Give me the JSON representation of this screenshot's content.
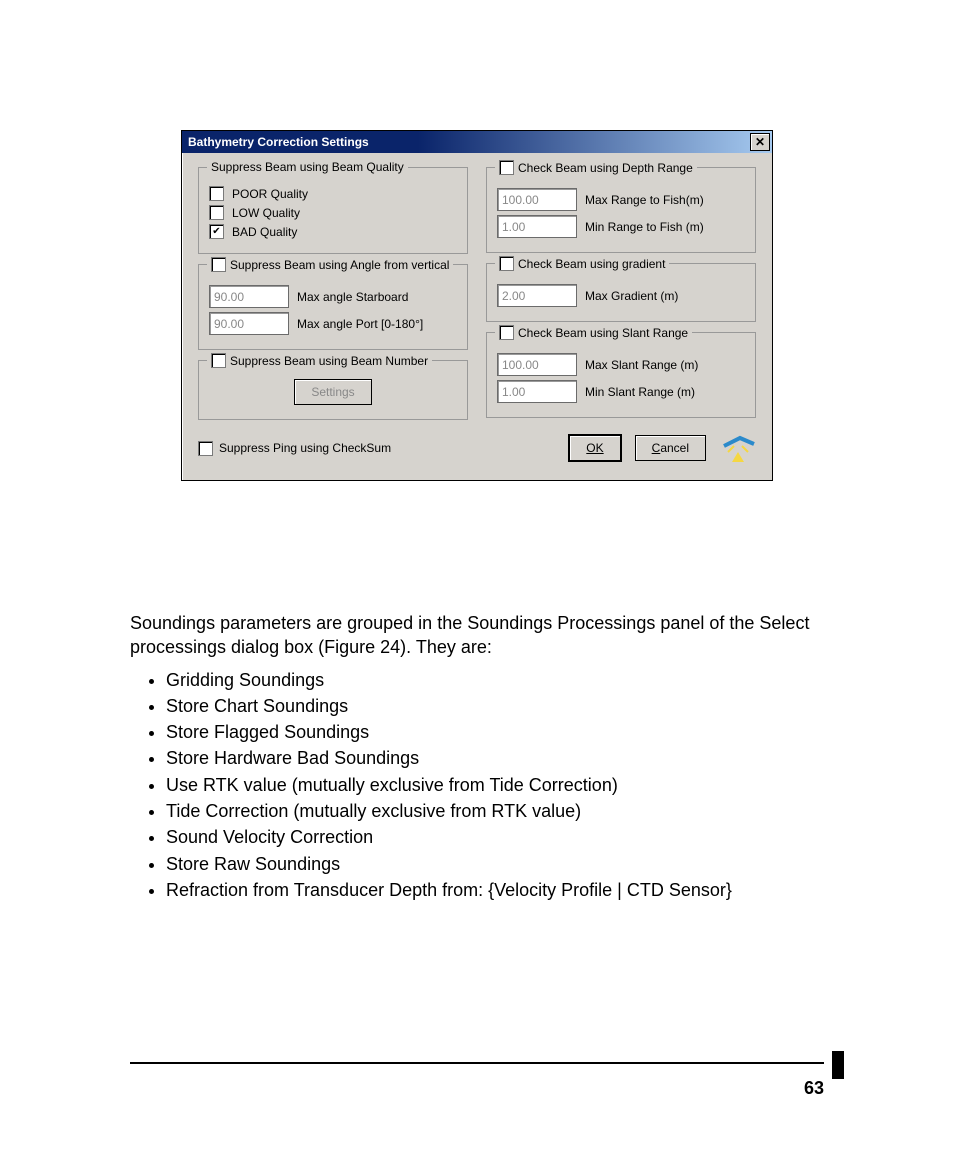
{
  "dialog": {
    "title": "Bathymetry Correction Settings",
    "groups": {
      "beamQuality": {
        "legend": "Suppress Beam using Beam Quality",
        "poor": {
          "label": "POOR Quality",
          "checked": false
        },
        "low": {
          "label": "LOW Quality",
          "checked": false
        },
        "bad": {
          "label": "BAD Quality",
          "checked": true
        }
      },
      "angle": {
        "legend": "Suppress Beam using Angle from vertical",
        "checked": false,
        "starboard_val": "90.00",
        "starboard_lbl": "Max angle Starboard",
        "port_val": "90.00",
        "port_lbl": "Max angle Port [0-180°]"
      },
      "beamNumber": {
        "legend": "Suppress Beam using Beam Number",
        "checked": false,
        "button": "Settings"
      },
      "depthRange": {
        "legend": "Check Beam using Depth Range",
        "checked": false,
        "max_val": "100.00",
        "max_lbl": "Max Range to Fish(m)",
        "min_val": "1.00",
        "min_lbl": "Min Range to Fish (m)"
      },
      "gradient": {
        "legend": "Check Beam using gradient",
        "checked": false,
        "val": "2.00",
        "lbl": "Max  Gradient (m)"
      },
      "slantRange": {
        "legend": "Check Beam using Slant Range",
        "checked": false,
        "max_val": "100.00",
        "max_lbl": "Max Slant Range (m)",
        "min_val": "1.00",
        "min_lbl": "Min Slant Range (m)"
      }
    },
    "checksum": {
      "label": "Suppress Ping using CheckSum",
      "checked": false
    },
    "ok": "OK",
    "cancel": "Cancel"
  },
  "doc": {
    "para": "Soundings parameters are grouped in the Soundings Processings panel of the Select processings dialog box (Figure 24). They are:",
    "items": [
      "Gridding Soundings",
      "Store Chart Soundings",
      "Store Flagged Soundings",
      "Store Hardware Bad Soundings",
      "Use RTK value (mutually exclusive from Tide Correction)",
      "Tide Correction (mutually exclusive from RTK value)",
      "Sound Velocity Correction",
      "Store Raw Soundings",
      "Refraction from Transducer Depth from: {Velocity Profile | CTD Sensor}"
    ]
  },
  "page_number": "63"
}
